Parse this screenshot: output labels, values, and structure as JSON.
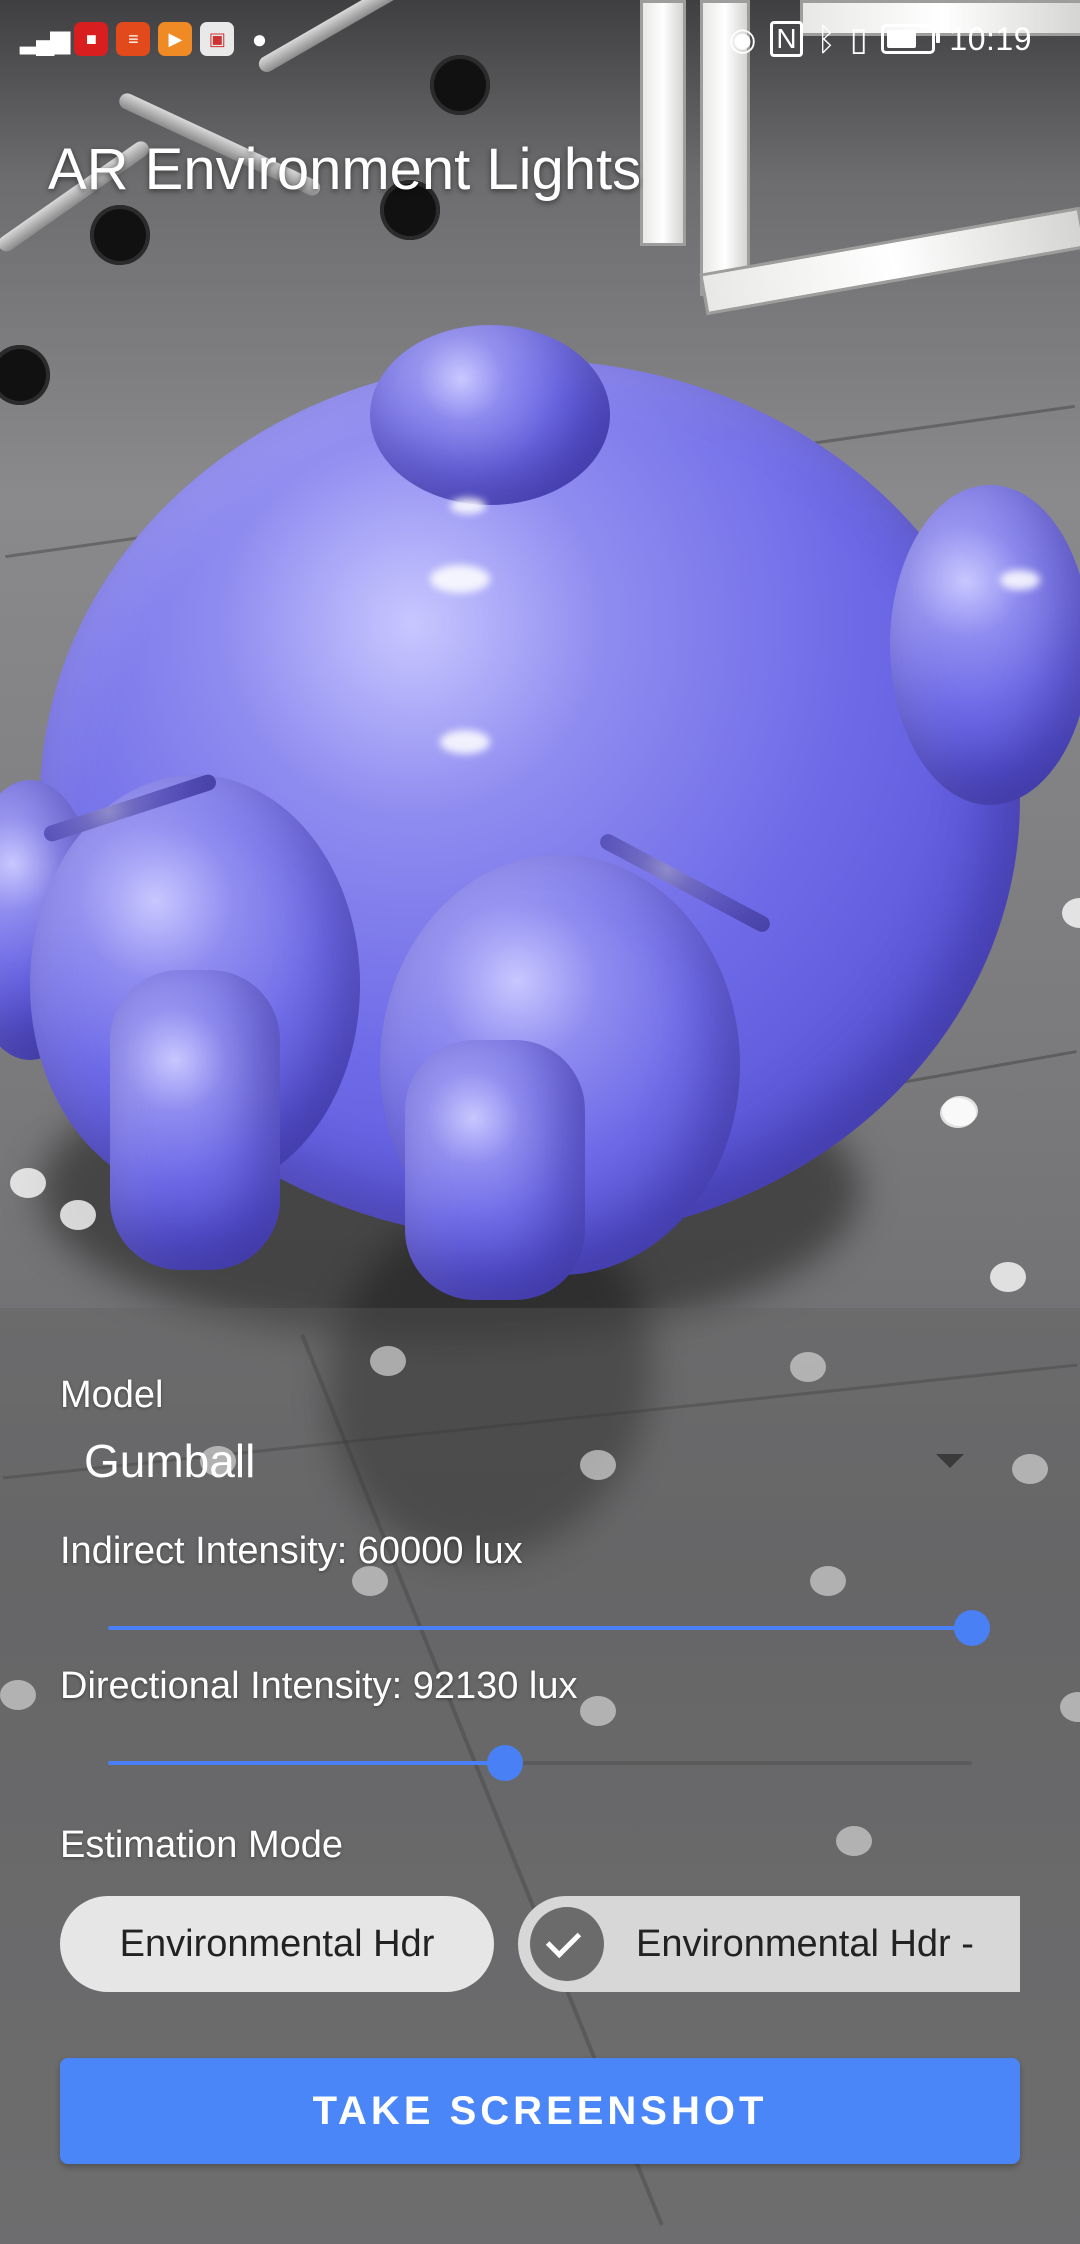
{
  "status_bar": {
    "time": "10:19",
    "left_icons": [
      "signal-icon",
      "video-app-icon",
      "news-app-icon",
      "player-app-icon",
      "store-app-icon",
      "wechat-icon"
    ],
    "right_icons": [
      "eye-comfort-icon",
      "nfc-icon",
      "bluetooth-icon",
      "vibrate-icon",
      "battery-icon"
    ],
    "battery_level": 0.6
  },
  "app": {
    "title": "AR Environment Lights"
  },
  "controls": {
    "model": {
      "label": "Model",
      "value": "Gumball"
    },
    "indirect": {
      "label": "Indirect Intensity: 60000 lux",
      "level": 1.0
    },
    "directional": {
      "label": "Directional Intensity: 92130 lux",
      "level": 0.46
    },
    "estimation": {
      "label": "Estimation Mode",
      "options": [
        "Environmental Hdr",
        "Environmental Hdr -"
      ],
      "selected_index": 1
    },
    "screenshot_button": "TAKE SCREENSHOT"
  },
  "colors": {
    "accent": "#4a86f7",
    "model_color": "#6f6be8"
  }
}
